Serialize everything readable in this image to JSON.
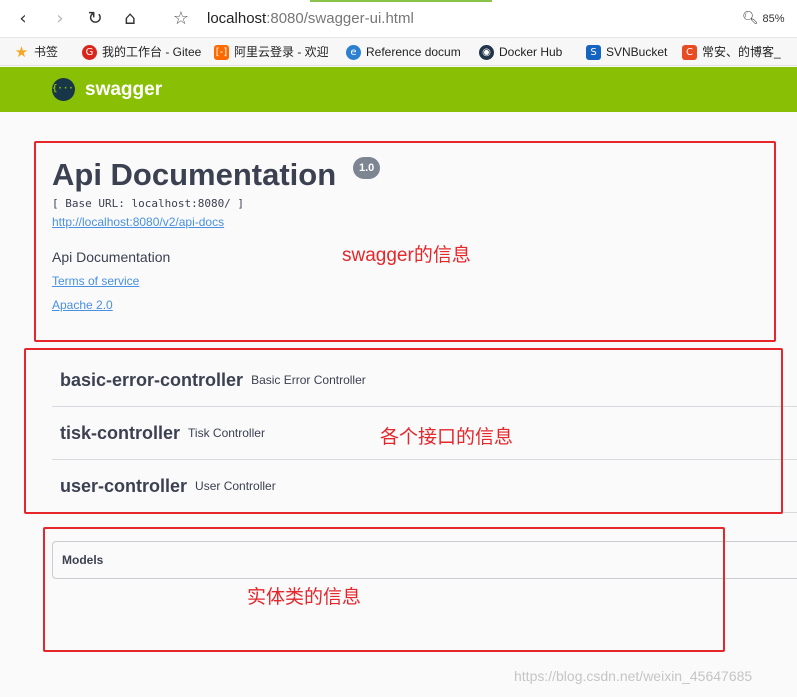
{
  "browser": {
    "url_host": "localhost",
    "url_rest": ":8080/swagger-ui.html",
    "zoom": "85%"
  },
  "bookmarks": [
    "书签",
    "我的工作台 - Gitee",
    "阿里云登录 - 欢迎",
    "Reference docum",
    "Docker Hub",
    "SVNBucket",
    "常安、的博客_"
  ],
  "swagger": {
    "logo_glyph": "{···}",
    "name": "swagger"
  },
  "info": {
    "title": "Api Documentation",
    "version": "1.0",
    "base_url": "[ Base URL: localhost:8080/ ]",
    "docs_link": "http://localhost:8080/v2/api-docs",
    "description": "Api Documentation",
    "terms": "Terms of service",
    "license": "Apache 2.0"
  },
  "controllers": [
    {
      "name": "basic-error-controller",
      "desc": "Basic Error Controller"
    },
    {
      "name": "tisk-controller",
      "desc": "Tisk Controller"
    },
    {
      "name": "user-controller",
      "desc": "User Controller"
    }
  ],
  "models": {
    "title": "Models"
  },
  "annotations": {
    "info": "swagger的信息",
    "controllers": "各个接口的信息",
    "models": "实体类的信息",
    "color": "#e5262b"
  },
  "watermark": "https://blog.csdn.net/weixin_45647685"
}
